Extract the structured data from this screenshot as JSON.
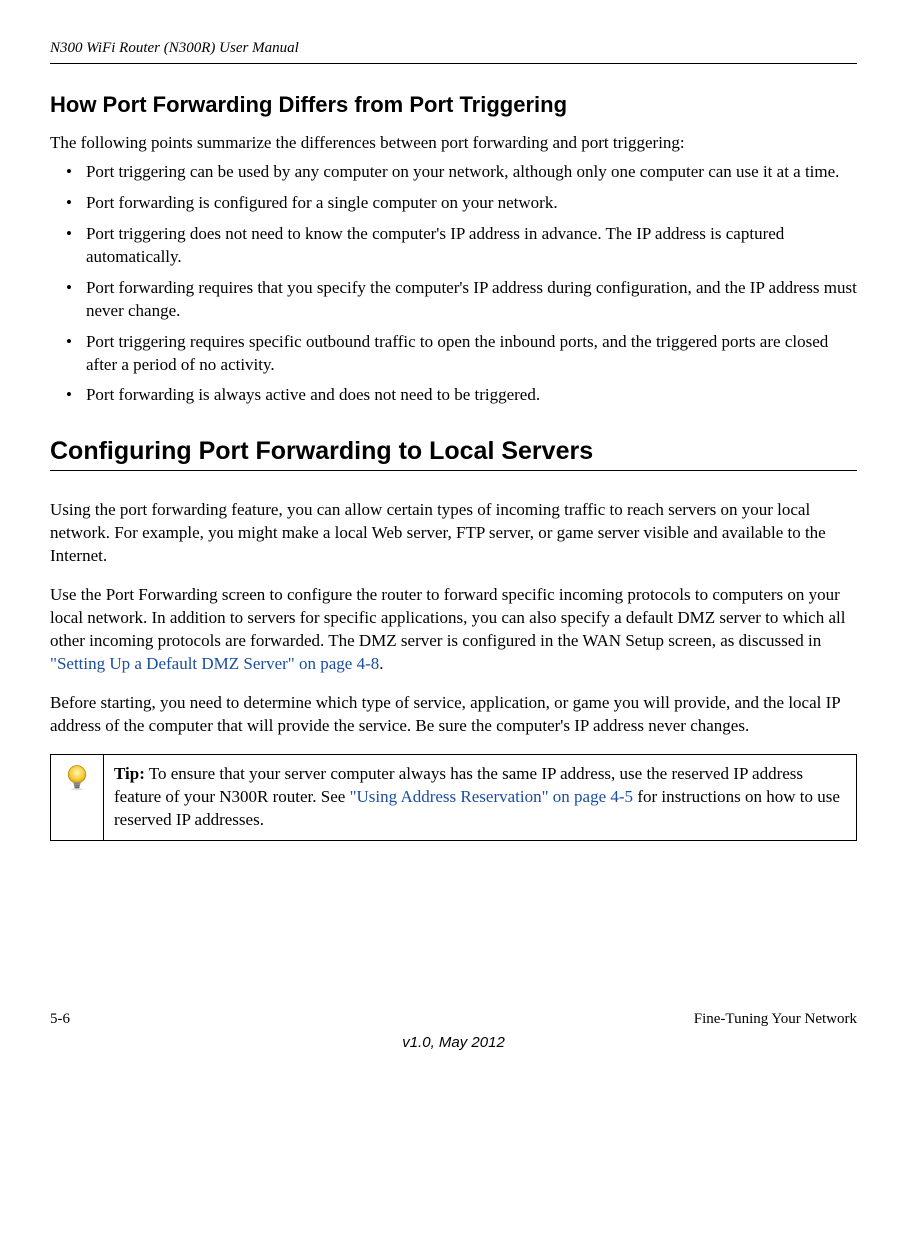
{
  "header": {
    "doc_title": "N300 WiFi Router (N300R) User Manual"
  },
  "section1": {
    "heading": "How Port Forwarding Differs from Port Triggering",
    "intro": "The following points summarize the differences between port forwarding and port triggering:",
    "bullets": [
      "Port triggering can be used by any computer on your network, although only one computer can use it at a time.",
      "Port forwarding is configured for a single computer on your network.",
      "Port triggering does not need to know the computer's IP address in advance. The IP address is captured automatically.",
      "Port forwarding requires that you specify the computer's IP address during configuration, and the IP address must never change.",
      "Port triggering requires specific outbound traffic to open the inbound ports, and the triggered ports are closed after a period of no activity.",
      "Port forwarding is always active and does not need to be triggered."
    ]
  },
  "section2": {
    "heading": "Configuring Port Forwarding to Local Servers",
    "para1": "Using the port forwarding feature, you can allow certain types of incoming traffic to reach servers on your local network. For example, you might make a local Web server, FTP server, or game server visible and available to the Internet.",
    "para2a": "Use the Port Forwarding screen to configure the router to forward specific incoming protocols to computers on your local network. In addition to servers for specific applications, you can also specify a default DMZ server to which all other incoming protocols are forwarded. The DMZ server is configured in the WAN Setup screen, as discussed in ",
    "para2_link": "\"Setting Up a Default DMZ Server\" on page 4-8",
    "para2b": ".",
    "para3": "Before starting, you need to determine which type of service, application, or game you will provide, and the local IP address of the computer that will provide the service. Be sure the computer's IP address never changes."
  },
  "tip": {
    "label": "Tip:",
    "text_a": " To ensure that your server computer always has the same IP address, use the reserved IP address feature of your N300R router. See ",
    "link": "\"Using Address Reservation\" on page 4-5",
    "text_b": " for instructions on how to use reserved IP addresses."
  },
  "footer": {
    "page": "5-6",
    "chapter": "Fine-Tuning Your Network",
    "version": "v1.0, May 2012"
  }
}
